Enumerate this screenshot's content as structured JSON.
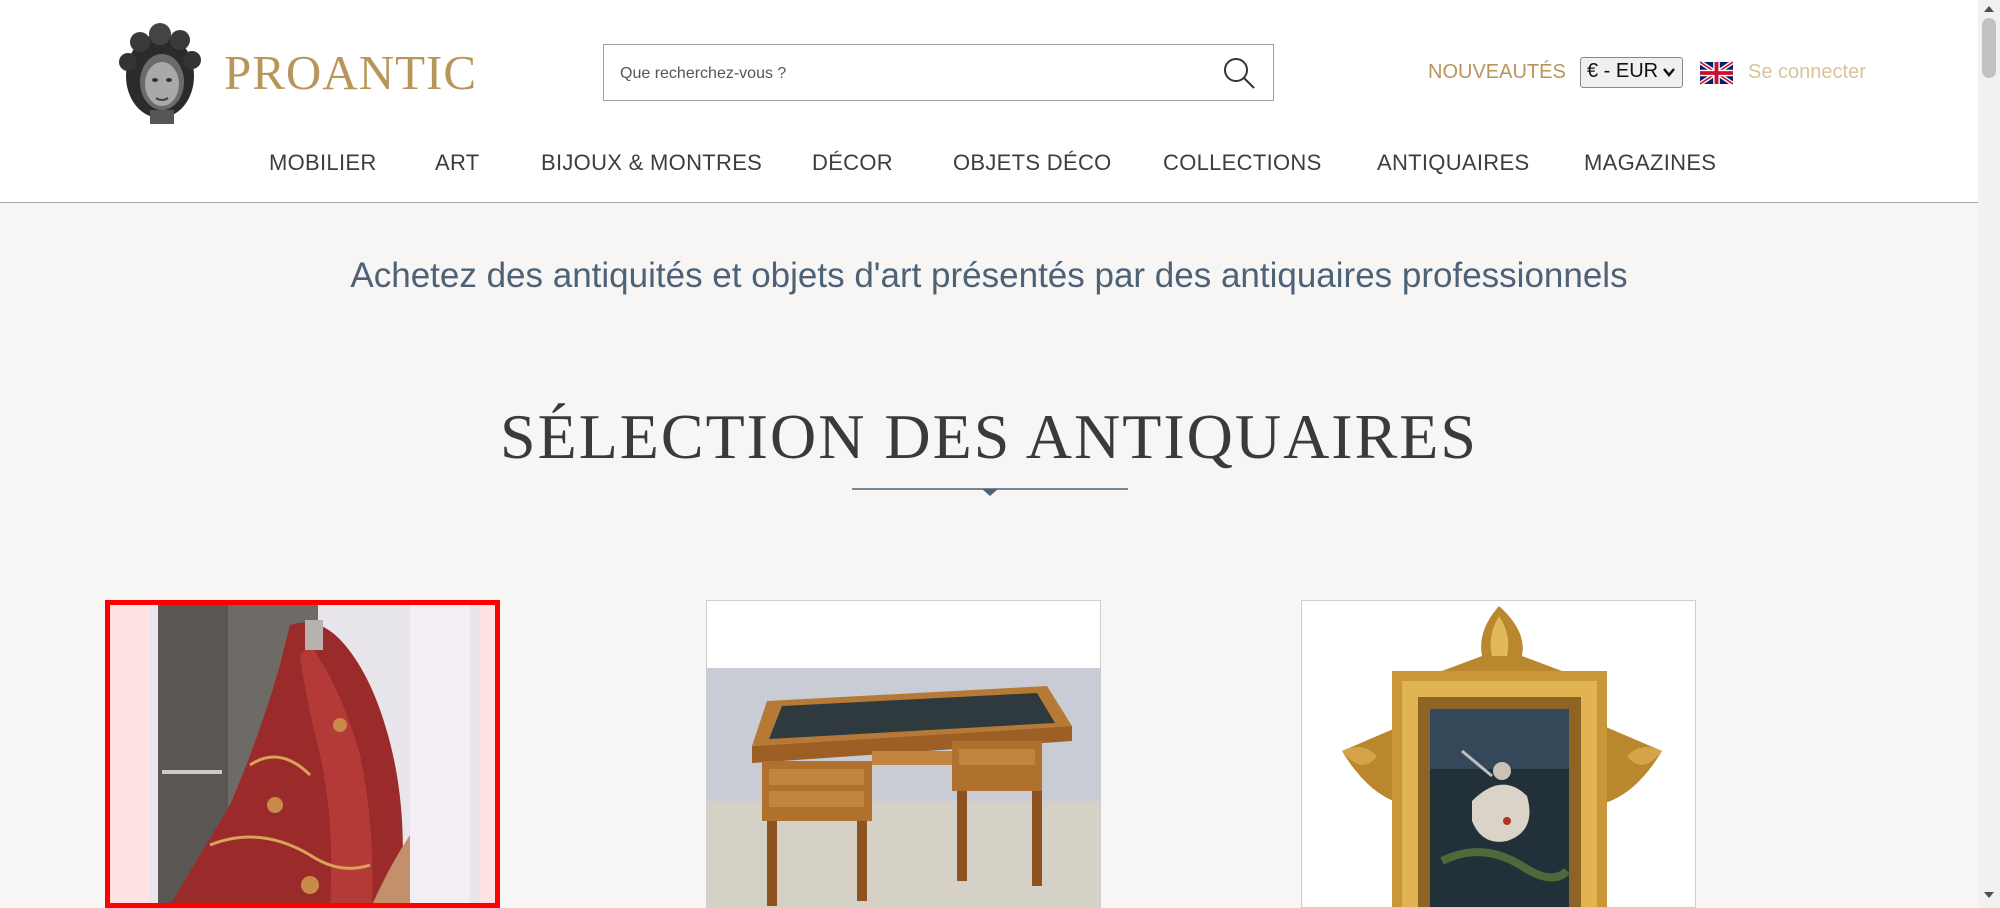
{
  "header": {
    "logo_text": "PROANTIC",
    "search": {
      "placeholder": "Que recherchez-vous ?"
    },
    "nouveautes_label": "NOUVEAUTÉS",
    "currency_selected": "€ - EUR",
    "language_flag": "uk-flag-icon",
    "login_label": "Se connecter"
  },
  "nav": {
    "items": [
      {
        "label": "MOBILIER"
      },
      {
        "label": "ART"
      },
      {
        "label": "BIJOUX & MONTRES"
      },
      {
        "label": "DÉCOR"
      },
      {
        "label": "OBJETS DÉCO"
      },
      {
        "label": "COLLECTIONS"
      },
      {
        "label": "ANTIQUAIRES"
      },
      {
        "label": "MAGAZINES"
      }
    ]
  },
  "main": {
    "tagline": "Achetez des antiquités et objets d'art présentés par des antiquaires professionnels",
    "section_title": "SÉLECTION DES ANTIQUAIRES",
    "cards": [
      {
        "image": "paisley-textile-photo",
        "selected": true
      },
      {
        "image": "writing-desk-photo",
        "selected": false
      },
      {
        "image": "gilt-frame-painting-photo",
        "selected": false
      }
    ]
  },
  "colors": {
    "brand_gold": "#b9955a",
    "tagline_blue": "#4e6277",
    "selection_red": "#ff0000",
    "page_background": "#f7f6f4"
  }
}
